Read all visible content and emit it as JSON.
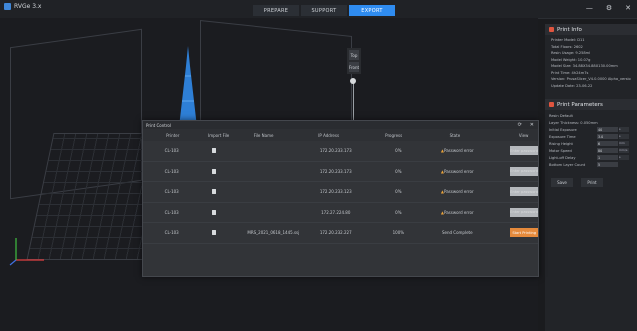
{
  "app": {
    "title": "RVGe 3.x"
  },
  "tabs": [
    {
      "label": "PREPARE",
      "active": false
    },
    {
      "label": "SUPPORT",
      "active": false
    },
    {
      "label": "EXPORT",
      "active": true
    }
  ],
  "window_controls": {
    "minimize": "—",
    "settings": "⚙",
    "close": "✕"
  },
  "viewport_tools": {
    "top": "Top",
    "second": "Front"
  },
  "print_info": {
    "title": "Print Info",
    "lines": [
      "Printer Model: D11",
      "Total Floors: 2602",
      "Resin Usage: 9.258ml",
      "Model Weight: 10.07g",
      "Model Size: 34.88X34.88X130.00mm",
      "Print Time: 4h24m7s",
      "Version: PrusaSlicer_V4.0.0000 Alpha_version",
      "Update Date: 23-06-22"
    ]
  },
  "print_params": {
    "title": "Print Parameters",
    "rows": [
      {
        "label": "Resin Default",
        "value": "",
        "unit": ""
      },
      {
        "label": "Layer Thickness: 0.050mm",
        "value": "",
        "unit": ""
      },
      {
        "label": "Initial Exposure",
        "value": "40",
        "unit": "s"
      },
      {
        "label": "Exposure Time",
        "value": "3.0",
        "unit": "s"
      },
      {
        "label": "Rising Height",
        "value": "6",
        "unit": "mm"
      },
      {
        "label": "Motor Speed",
        "value": "80",
        "unit": "mm/s"
      },
      {
        "label": "Light-off Delay",
        "value": "1",
        "unit": "s"
      },
      {
        "label": "Bottom Layer Count",
        "value": "5",
        "unit": ""
      }
    ],
    "save_label": "Save",
    "print_label": "Print"
  },
  "print_control": {
    "title": "Print Control",
    "refresh_icon": "⟳",
    "close_icon": "✕",
    "columns": [
      "Printer",
      "Import File",
      "File Name",
      "IP Address",
      "Progress",
      "State",
      "View"
    ],
    "rows": [
      {
        "printer": "CL-103",
        "file_name": "",
        "ip": "172.20.233.173",
        "progress": "0%",
        "state": "Password error",
        "warning": true,
        "view": "Enter password",
        "view_active": false
      },
      {
        "printer": "CL-103",
        "file_name": "",
        "ip": "172.20.233.173",
        "progress": "0%",
        "state": "Password error",
        "warning": true,
        "view": "Enter password",
        "view_active": false
      },
      {
        "printer": "CL-103",
        "file_name": "",
        "ip": "172.20.233.123",
        "progress": "0%",
        "state": "Password error",
        "warning": true,
        "view": "Enter password",
        "view_active": false
      },
      {
        "printer": "CL-103",
        "file_name": "",
        "ip": "172.27.224.80",
        "progress": "0%",
        "state": "Password error",
        "warning": true,
        "view": "Enter password",
        "view_active": false
      },
      {
        "printer": "CL-103",
        "file_name": "MRS_2021_0618_1445.ssjhprt",
        "ip": "172.20.232.227",
        "progress": "100%",
        "state": "Send Complete",
        "warning": false,
        "view": "Start Printing",
        "view_active": true
      }
    ]
  }
}
